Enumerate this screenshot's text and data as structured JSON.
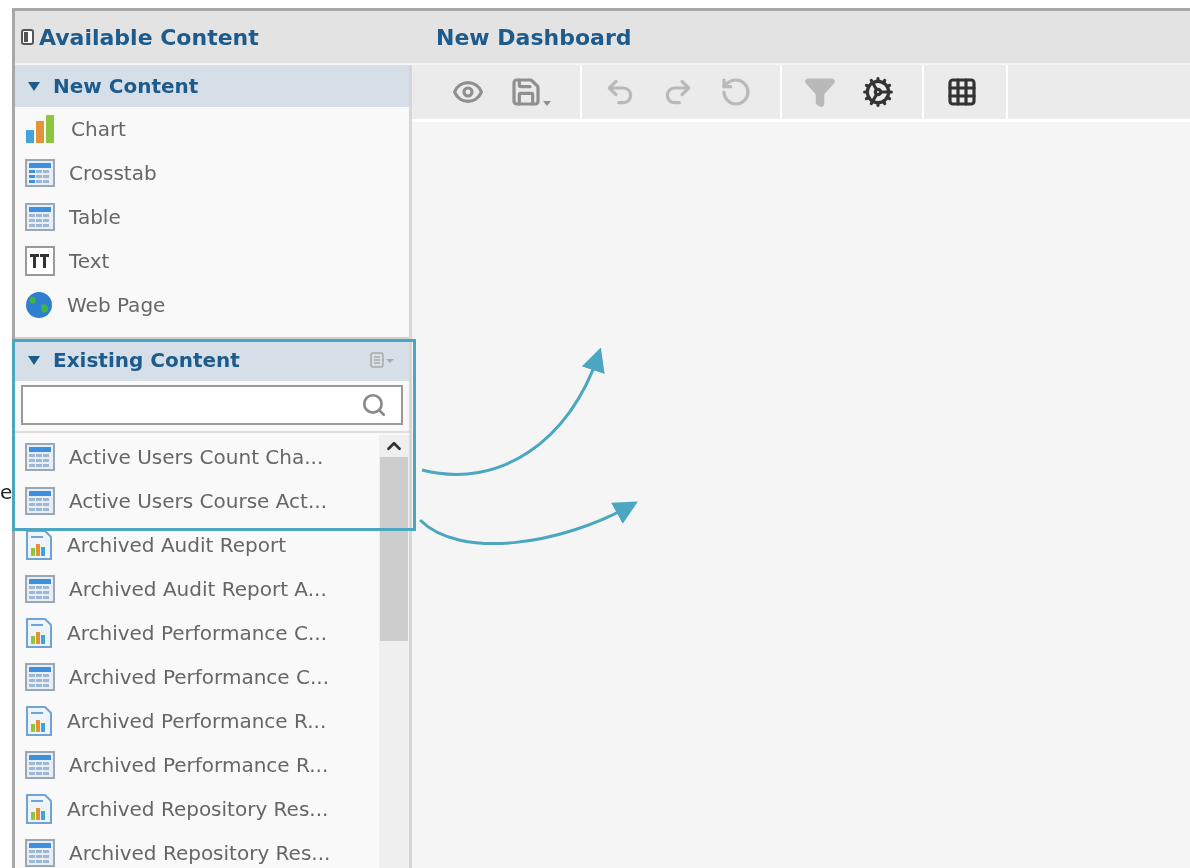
{
  "margin_fragment": "e",
  "sidebar": {
    "title": "Available Content",
    "sections": [
      {
        "title": "New Content",
        "expanded": true,
        "items": [
          {
            "label": "Chart",
            "kind": "chart"
          },
          {
            "label": "Crosstab",
            "kind": "crosstab"
          },
          {
            "label": "Table",
            "kind": "table"
          },
          {
            "label": "Text",
            "kind": "text"
          },
          {
            "label": "Web Page",
            "kind": "webpage"
          }
        ]
      },
      {
        "title": "Existing Content",
        "expanded": true,
        "kind": "searchable",
        "items": [
          {
            "label": "Active Users Count Cha...",
            "kind": "table"
          },
          {
            "label": "Active Users Course Act...",
            "kind": "table"
          },
          {
            "label": "Archived Audit Report",
            "kind": "chart-report"
          },
          {
            "label": "Archived Audit Report A...",
            "kind": "table"
          },
          {
            "label": "Archived Performance C...",
            "kind": "chart-report"
          },
          {
            "label": "Archived Performance C...",
            "kind": "table"
          },
          {
            "label": "Archived Performance R...",
            "kind": "chart-report"
          },
          {
            "label": "Archived Performance R...",
            "kind": "table"
          },
          {
            "label": "Archived Repository Res...",
            "kind": "chart-report"
          },
          {
            "label": "Archived Repository Res...",
            "kind": "table"
          }
        ]
      }
    ]
  },
  "dashboard": {
    "title": "New Dashboard",
    "toolbar": [
      [
        {
          "kind": "preview",
          "disabled": false
        },
        {
          "kind": "save",
          "disabled": false
        }
      ],
      [
        {
          "kind": "undo",
          "disabled": true
        },
        {
          "kind": "redo",
          "disabled": true
        },
        {
          "kind": "reset",
          "disabled": true
        }
      ],
      [
        {
          "kind": "filter",
          "disabled": true
        },
        {
          "kind": "settings",
          "disabled": false
        }
      ],
      [
        {
          "kind": "grid",
          "disabled": false
        }
      ]
    ]
  }
}
